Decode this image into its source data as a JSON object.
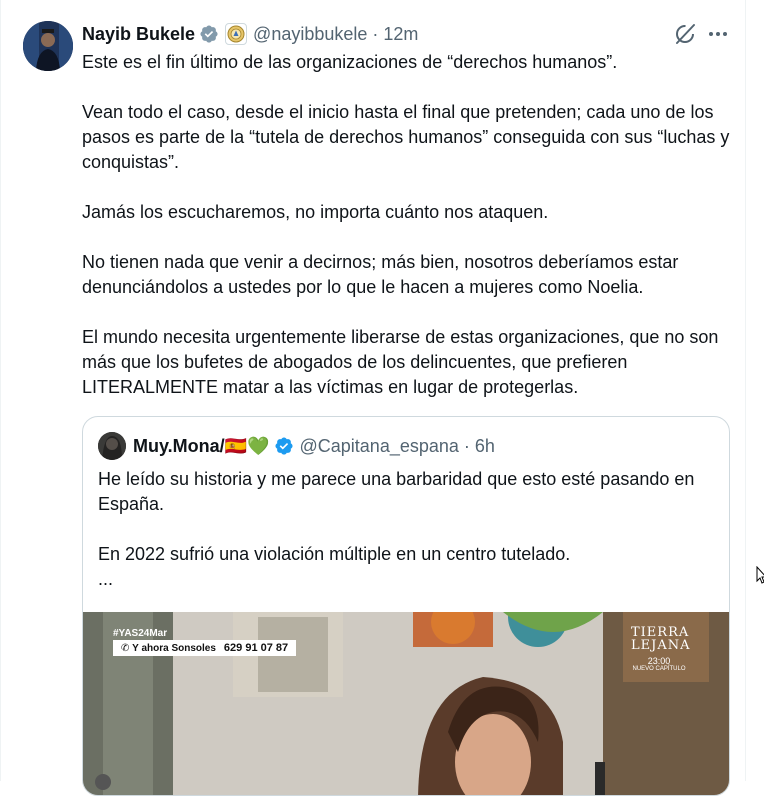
{
  "author": {
    "name": "Nayib Bukele",
    "handle": "@nayibbukele",
    "time": "12m",
    "separator": "·"
  },
  "icons": {
    "verified": "verified-badge-icon",
    "affiliate": "el-salvador-seal-icon",
    "grok": "grok-icon",
    "more": "more-icon"
  },
  "tweet": {
    "paragraphs": [
      "Este es el fin último de las organizaciones de “derechos humanos”.",
      "Vean todo el caso, desde el inicio hasta el final que pretenden; cada uno de los pasos es parte de la “tutela de derechos humanos” conseguida con sus “luchas y conquistas”.",
      "Jamás los escucharemos, no importa cuánto nos ataquen.",
      "No tienen nada que venir a decirnos; más bien, nosotros deberíamos estar denunciándolos a ustedes por lo que le hacen a mujeres como Noelia.",
      "El mundo necesita urgentemente liberarse de estas organizaciones, que no son más que los bufetes de abogados de los delincuentes, que prefieren LITERALMENTE matar a las víctimas en lugar de protegerlas."
    ]
  },
  "quote": {
    "name": "Muy.Mona/",
    "emojis": "🇪🇸💚",
    "handle": "@Capitana_espana",
    "time": "6h",
    "separator": "·",
    "line1": "He leído su historia y me parece una barbaridad que esto esté pasando en España.",
    "line2": "En 2022 sufrió una violación múltiple en un centro tutelado.",
    "line3": "...",
    "media": {
      "hashtag": "#YAS24Mar",
      "phone_label": "Y ahora Sonsoles",
      "phone_number": "629 91 07 87",
      "show_title_1": "TIERRA",
      "show_title_2": "LEJANA",
      "show_time": "23:00",
      "show_sub": "NUEVO CAPÍTULO"
    }
  },
  "colors": {
    "text": "#0f1419",
    "secondary": "#536471",
    "verified": "#1d9bf0",
    "border": "#cfd9de"
  }
}
